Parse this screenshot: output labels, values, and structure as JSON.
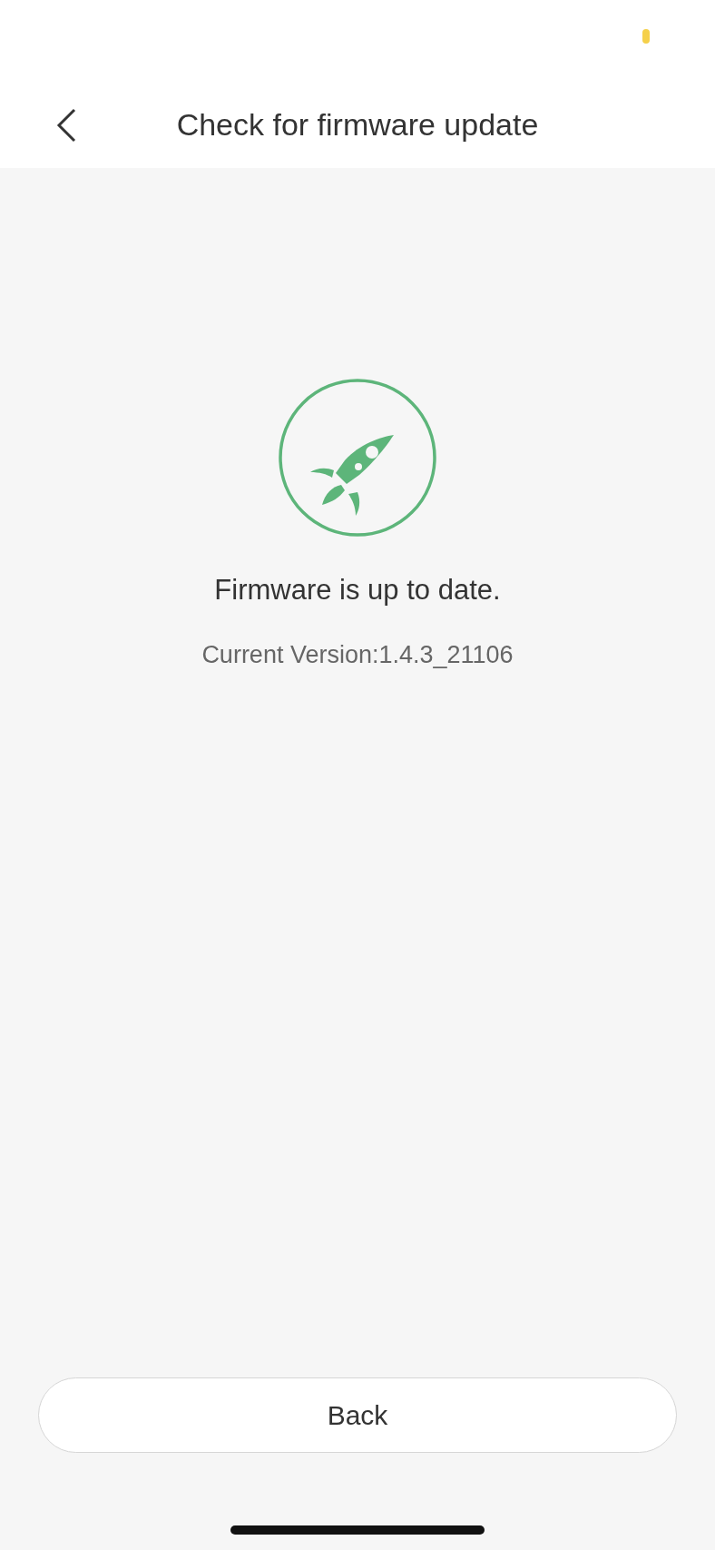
{
  "header": {
    "title": "Check for firmware update"
  },
  "status": {
    "message": "Firmware is up to date.",
    "version": "Current Version:1.4.3_21106"
  },
  "buttons": [
    {
      "label": "Back"
    }
  ]
}
